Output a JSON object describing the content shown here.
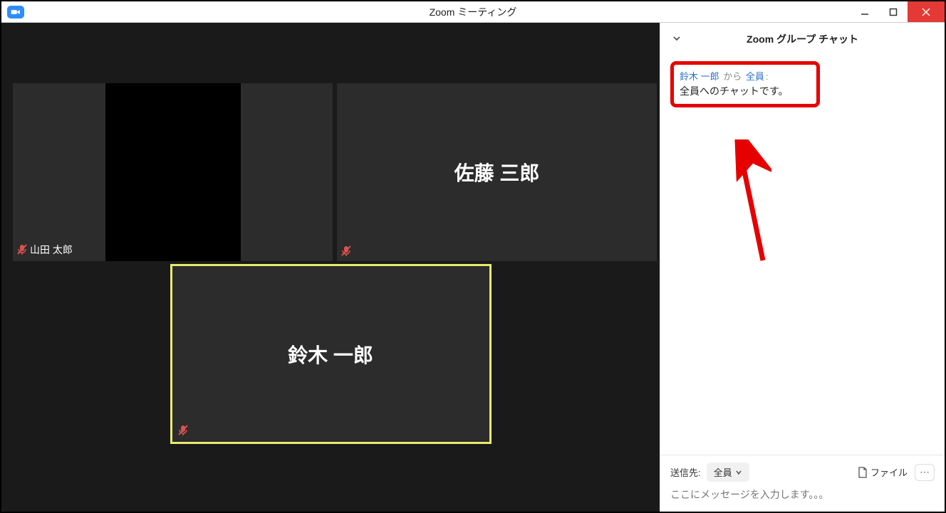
{
  "window": {
    "title": "Zoom ミーティング"
  },
  "participants": {
    "tile1_label": "山田 太郎",
    "tile2_name": "佐藤 三郎",
    "tile3_name": "鈴木 一郎"
  },
  "chat": {
    "header_title": "Zoom グループ チャット",
    "message": {
      "sender": "鈴木 一郎",
      "from_label": "から",
      "receiver": "全員",
      "colon": ":",
      "text": "全員へのチャットです。"
    },
    "footer": {
      "send_to_label": "送信先:",
      "recipient": "全員",
      "file_label": "ファイル",
      "input_placeholder": "ここにメッセージを入力します。。。"
    }
  }
}
